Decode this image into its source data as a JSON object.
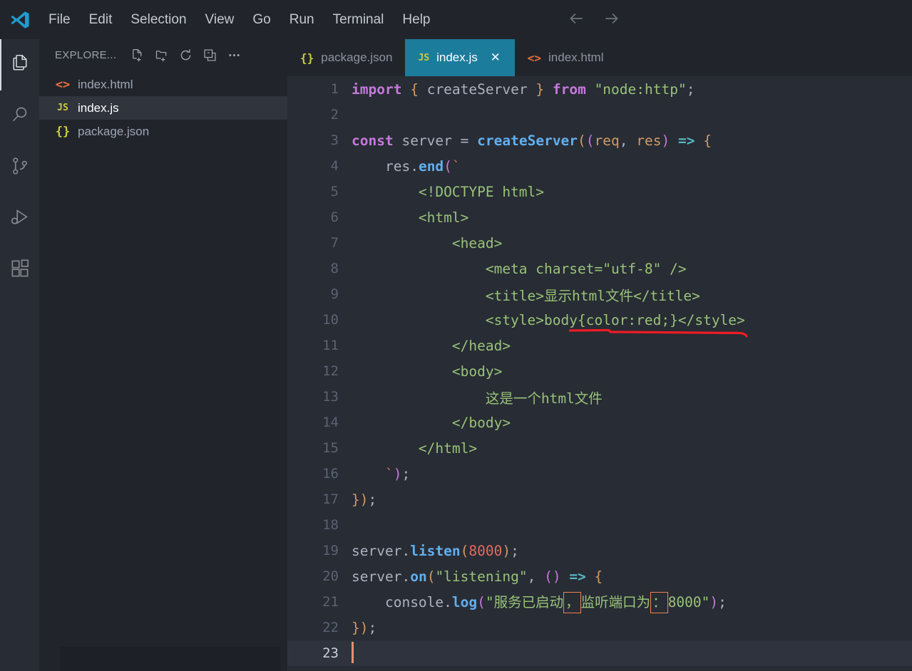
{
  "window": {
    "app": "Visual Studio Code",
    "logo_icon": "vscode-logo-icon",
    "menu": [
      {
        "label": "File"
      },
      {
        "label": "Edit"
      },
      {
        "label": "Selection"
      },
      {
        "label": "View"
      },
      {
        "label": "Go"
      },
      {
        "label": "Run"
      },
      {
        "label": "Terminal"
      },
      {
        "label": "Help"
      }
    ],
    "nav": {
      "back_icon": "arrow-left-icon",
      "forward_icon": "arrow-right-icon"
    }
  },
  "activity_bar": {
    "items": [
      {
        "name": "explorer",
        "icon": "files-icon",
        "active": true
      },
      {
        "name": "search",
        "icon": "search-icon",
        "active": false
      },
      {
        "name": "source-control",
        "icon": "source-control-icon",
        "active": false
      },
      {
        "name": "run-and-debug",
        "icon": "run-debug-icon",
        "active": false
      },
      {
        "name": "extensions",
        "icon": "extensions-icon",
        "active": false
      }
    ]
  },
  "sidebar": {
    "title": "EXPLORE...",
    "actions": [
      {
        "name": "new-file",
        "icon": "new-file-icon"
      },
      {
        "name": "new-folder",
        "icon": "new-folder-icon"
      },
      {
        "name": "refresh",
        "icon": "refresh-icon"
      },
      {
        "name": "collapse-all",
        "icon": "collapse-all-icon"
      },
      {
        "name": "more-actions",
        "icon": "ellipsis-icon"
      }
    ],
    "files": [
      {
        "name": "index.html",
        "icon": "html-file-icon",
        "icon_glyph": "<>",
        "kind": "html",
        "selected": false
      },
      {
        "name": "index.js",
        "icon": "js-file-icon",
        "icon_glyph": "JS",
        "kind": "js",
        "selected": true
      },
      {
        "name": "package.json",
        "icon": "json-file-icon",
        "icon_glyph": "{}",
        "kind": "json",
        "selected": false
      }
    ]
  },
  "editor": {
    "tabs": [
      {
        "label": "package.json",
        "icon_glyph": "{}",
        "kind": "json",
        "active": false,
        "closable": false
      },
      {
        "label": "index.js",
        "icon_glyph": "JS",
        "kind": "js",
        "active": true,
        "closable": true,
        "close_glyph": "✕"
      },
      {
        "label": "index.html",
        "icon_glyph": "<>",
        "kind": "html",
        "active": false,
        "closable": false
      }
    ],
    "active_file": "index.js",
    "cursor_line": 23,
    "line_numbers": [
      "1",
      "2",
      "3",
      "4",
      "5",
      "6",
      "7",
      "8",
      "9",
      "10",
      "11",
      "12",
      "13",
      "14",
      "15",
      "16",
      "17",
      "18",
      "19",
      "20",
      "21",
      "22",
      "23"
    ],
    "code_lines": [
      "import { createServer } from \"node:http\";",
      "",
      "const server = createServer((req, res) => {",
      "    res.end(`",
      "        <!DOCTYPE html>",
      "        <html>",
      "            <head>",
      "                <meta charset=\"utf-8\" />",
      "                <title>显示html文件</title>",
      "                <style>body{color:red;}</style>",
      "            </head>",
      "            <body>",
      "                这是一个html文件",
      "            </body>",
      "        </html>",
      "    `);",
      "});",
      "",
      "server.listen(8000);",
      "server.on(\"listening\", () => {",
      "    console.log(\"服务已启动，监听端口为：8000\");",
      "});",
      ""
    ]
  },
  "annotations": {
    "underline": {
      "name": "red-underline-annotation",
      "target_text": "body{color:red;}",
      "color": "#ee1c25",
      "line": 10
    },
    "unicode_highlights": [
      {
        "char": "，",
        "name": "fullwidth-comma",
        "line": 21,
        "color": "#ef8354"
      },
      {
        "char": "：",
        "name": "fullwidth-colon",
        "line": 21,
        "color": "#ef8354"
      }
    ]
  },
  "theme": {
    "editor_background": "#282c34",
    "sidebar_background": "#21252b",
    "active_tab_background": "#1c7c9c",
    "accent_cursor": "#ff8b71",
    "keyword": "#c678dd",
    "function": "#61afef",
    "string": "#98c379",
    "number": "#e06c5f",
    "operator": "#56b6c2",
    "bracket": "#d19a66"
  }
}
